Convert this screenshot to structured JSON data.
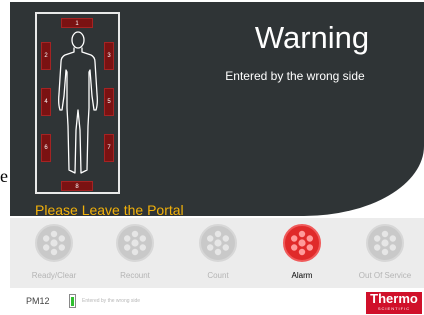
{
  "panel": {
    "title": "Warning",
    "subtitle": "Entered by the wrong side",
    "message": "Please Leave the Portal",
    "edge_char": "e"
  },
  "detectors": {
    "top": "1",
    "left": [
      "2",
      "4",
      "6"
    ],
    "right": [
      "3",
      "5",
      "7"
    ],
    "bottom": "8"
  },
  "buttons": [
    {
      "label": "Ready/Clear",
      "icon": "detector-cluster-icon",
      "active": false
    },
    {
      "label": "Recount",
      "icon": "detector-cluster-icon",
      "active": false
    },
    {
      "label": "Count",
      "icon": "detector-cluster-icon",
      "active": false
    },
    {
      "label": "Alarm",
      "icon": "detector-cluster-icon",
      "active": true
    },
    {
      "label": "Out Of Service",
      "icon": "detector-cluster-icon",
      "active": false
    }
  ],
  "status": {
    "unit": "PM12",
    "battery_level": 0.9,
    "text": "Entered by the wrong side"
  },
  "logo": {
    "main": "Thermo",
    "sub": "SCIENTIFIC"
  },
  "colors": {
    "panel": "#2f3436",
    "detector": "#7a1212",
    "warning_text": "#f2b10a",
    "alarm_active": "#e02a2a",
    "logo": "#d0102a"
  }
}
